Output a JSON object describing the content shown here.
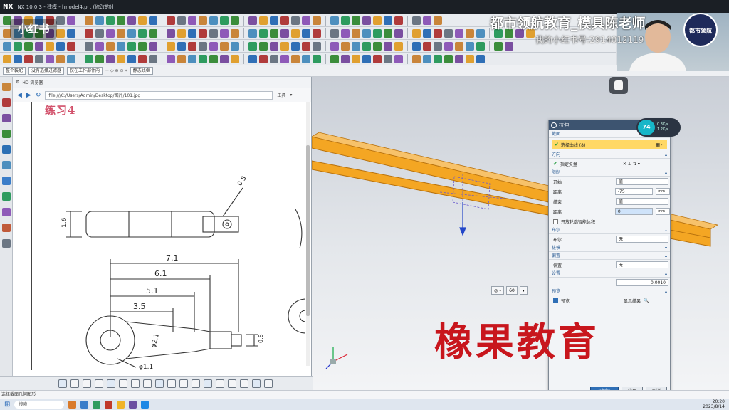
{
  "titlebar": {
    "app": "NX",
    "title": "NX 10.0.3 - 建模 - [model4.prt (修改的)]"
  },
  "overlays": {
    "platform_logo": "小红书",
    "brand_title": "都市领航教育_模具陈老师",
    "brand_subtitle": "我的小红书号:2914012119",
    "channel_logo": "都市领航",
    "watermark": "橡果教育"
  },
  "toolbar": {
    "filter_dropdown": "整个装配",
    "selection_dropdown": "没有选择过滤器",
    "assembly_dropdown": "仅在工作部件内",
    "snap_dropdown": "静态线框"
  },
  "browser": {
    "panel_title": "HD 浏览器",
    "url": "file:///C:/Users/Admin/Desktop/图片/101.jpg",
    "tools_label": "工具",
    "drawing_title": "练习4",
    "dims": {
      "d71": "7.1",
      "d61": "6.1",
      "d51": "5.1",
      "d35": "3.5",
      "d16": "1.6",
      "dphi21": "φ2.1",
      "dphi11": "φ1.1",
      "d05": "0.5",
      "d08": "0.8"
    }
  },
  "dialog": {
    "title": "拉伸",
    "sect_section": "截面",
    "select_curve": "选择曲线 (8)",
    "sect_direction": "方向",
    "specify_vector": "指定矢量",
    "sect_limits": "限制",
    "start_label": "开始",
    "start_value": "值",
    "distance_label": "距离",
    "distance_value": "-75",
    "distance_unit": "mm",
    "end_label": "结束",
    "end_value": "值",
    "end_distance_label": "距离",
    "end_distance_value": "0",
    "end_unit": "mm",
    "open_profile": "开放轮廓智能体积",
    "sect_boolean": "布尔",
    "boolean_label": "布尔",
    "boolean_value": "无",
    "sect_draft": "拔模",
    "sect_offset": "偏置",
    "offset_label": "偏置",
    "offset_value": "无",
    "sect_settings": "设置",
    "tolerance_value": "0.0010",
    "sect_preview": "预览",
    "preview_label": "预览",
    "show_result": "显示结果",
    "ok": "<确定>",
    "apply": "应用",
    "cancel": "取消"
  },
  "perf": {
    "percent": "74",
    "up": "0.3K/s",
    "down": "1.2K/s"
  },
  "viewport": {
    "view_dropdown": "",
    "zoom_value": "60"
  },
  "cueline": "选择截面几何图形",
  "taskbar": {
    "search": "搜索",
    "time": "20:20",
    "date": "2023/8/14"
  },
  "colors": {
    "part_orange": "#f4a623",
    "dialog_header": "#3d5470",
    "section_header": "#2f5f96",
    "selection_highlight": "#ffd866",
    "watermark_red": "#c8161d"
  }
}
